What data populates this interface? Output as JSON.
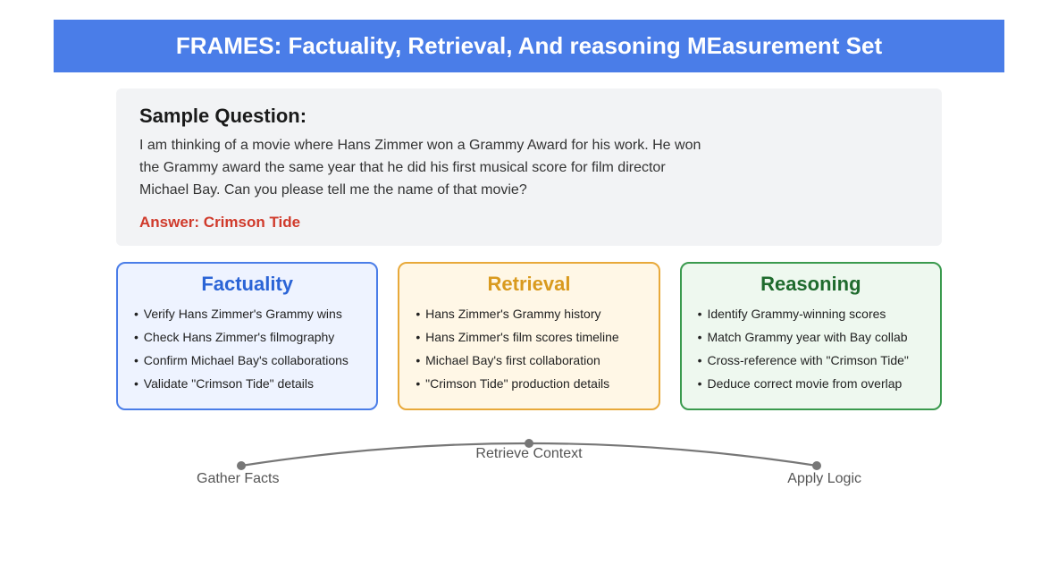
{
  "banner": "FRAMES: Factuality, Retrieval, And reasoning MEasurement Set",
  "sample": {
    "title": "Sample Question:",
    "question": "I am thinking of a movie where Hans Zimmer won a Grammy Award for his work. He won the Grammy award the same year that he did his first musical score for film director Michael Bay. Can you please tell me the name of that movie?",
    "answer": "Answer: Crimson Tide"
  },
  "cards": {
    "factuality": {
      "title": "Factuality",
      "items": [
        "Verify Hans Zimmer's Grammy wins",
        "Check Hans Zimmer's filmography",
        "Confirm Michael Bay's collaborations",
        "Validate \"Crimson Tide\" details"
      ]
    },
    "retrieval": {
      "title": "Retrieval",
      "items": [
        "Hans Zimmer's Grammy history",
        "Hans Zimmer's film scores timeline",
        "Michael Bay's first collaboration",
        "\"Crimson Tide\" production details"
      ]
    },
    "reasoning": {
      "title": "Reasoning",
      "items": [
        "Identify Grammy-winning scores",
        "Match Grammy year with Bay collab",
        "Cross-reference with \"Crimson Tide\"",
        "Deduce correct movie from overlap"
      ]
    }
  },
  "arc": {
    "left": "Gather Facts",
    "mid": "Retrieve Context",
    "right": "Apply Logic"
  }
}
